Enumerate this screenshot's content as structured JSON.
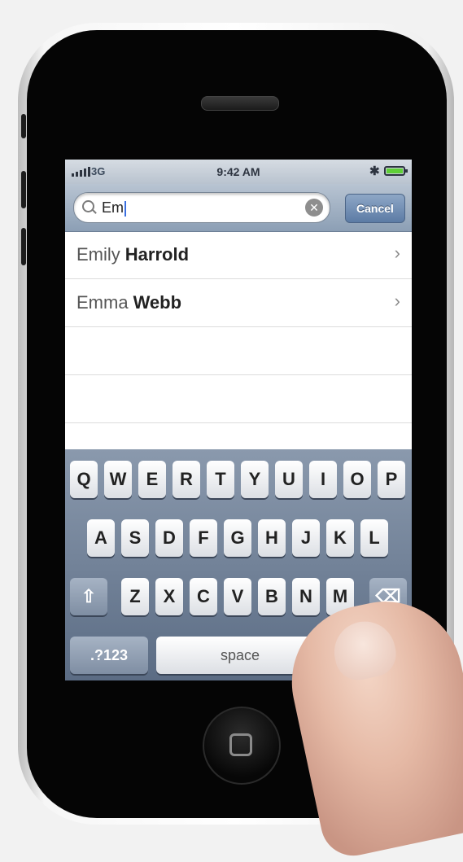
{
  "status_bar": {
    "network": "3G",
    "time": "9:42 AM"
  },
  "search": {
    "query": "Em",
    "cancel_label": "Cancel"
  },
  "results": [
    {
      "first": "Emily",
      "last": "Harrold"
    },
    {
      "first": "Emma",
      "last": "Webb"
    }
  ],
  "keyboard": {
    "row1": [
      "Q",
      "W",
      "E",
      "R",
      "T",
      "Y",
      "U",
      "I",
      "O",
      "P"
    ],
    "row2": [
      "A",
      "S",
      "D",
      "F",
      "G",
      "H",
      "J",
      "K",
      "L"
    ],
    "row3": [
      "Z",
      "X",
      "C",
      "V",
      "B",
      "N",
      "M"
    ],
    "numbers_label": ".?123",
    "space_label": "space"
  },
  "icons": [
    "signal-icon",
    "bluetooth-icon",
    "battery-icon",
    "search-icon",
    "clear-icon",
    "chevron-right-icon",
    "shift-icon",
    "backspace-icon",
    "home-button-icon"
  ]
}
